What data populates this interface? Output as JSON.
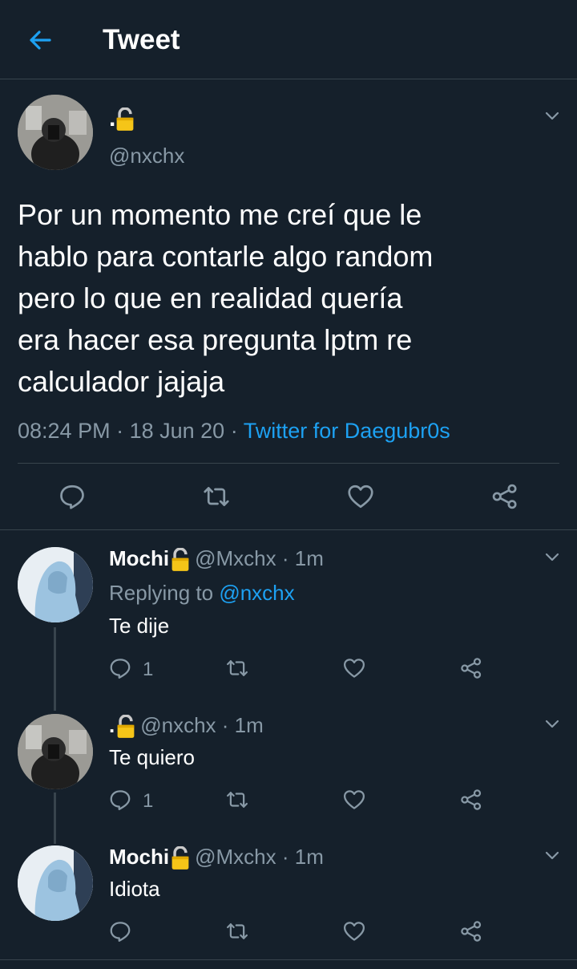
{
  "header": {
    "title": "Tweet"
  },
  "main_tweet": {
    "display_name": ".",
    "handle": "@nxchx",
    "text_lines": [
      "Por un momento me creí que le",
      "hablo para contarle algo random",
      "pero lo que en realidad quería",
      "era hacer esa pregunta lptm re",
      "calculador jajaja"
    ],
    "time": "08:24 PM",
    "sep1": " · ",
    "date": "18 Jun 20",
    "sep2": " · ",
    "source": "Twitter for Daegubr0s"
  },
  "replies": [
    {
      "name": "Mochi",
      "handle": "@Mxchx",
      "time": "· 1m",
      "replying_prefix": "Replying to ",
      "replying_to": "@nxchx",
      "text": "Te dije",
      "reply_count": "1"
    },
    {
      "name": ".",
      "handle": "@nxchx",
      "time": "· 1m",
      "text": "Te quiero",
      "reply_count": "1"
    },
    {
      "name": "Mochi",
      "handle": "@Mxchx",
      "time": "· 1m",
      "text": "Idiota"
    }
  ],
  "colors": {
    "background": "#15202b",
    "accent": "#1da1f2",
    "muted": "#8899a6",
    "lock": "#f5c518"
  },
  "icons": [
    "back-arrow-icon",
    "lock-icon",
    "chevron-down-icon",
    "reply-icon",
    "retweet-icon",
    "like-icon",
    "share-icon"
  ]
}
